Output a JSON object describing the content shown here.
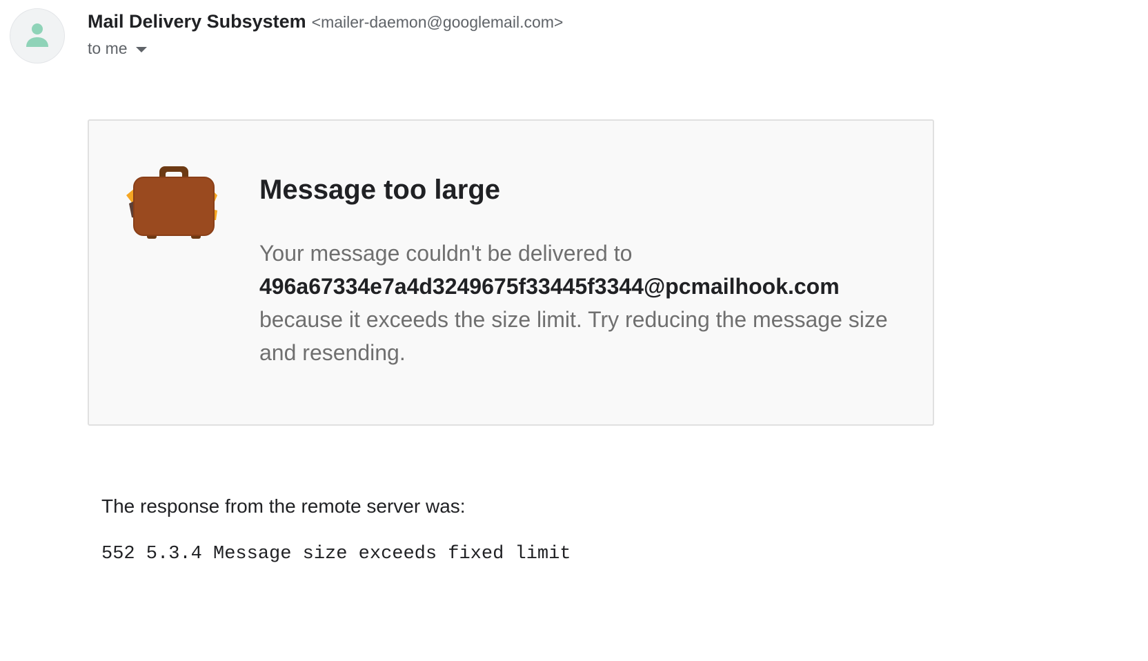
{
  "header": {
    "sender_name": "Mail Delivery Subsystem",
    "sender_email": "<mailer-daemon@googlemail.com>",
    "recipient_label": "to me",
    "avatar_icon": "person-icon",
    "avatar_color": "#8fd3b8"
  },
  "card": {
    "icon": "suitcase-icon",
    "title": "Message too large",
    "body_before": "Your message couldn't be delivered to",
    "recipient": "496a67334e7a4d3249675f33445f3344@pcmailhook.com",
    "body_after": "because it exceeds the size limit. Try reducing the message size and resending."
  },
  "response": {
    "label": "The response from the remote server was:",
    "code": "552 5.3.4 Message size exceeds fixed limit"
  }
}
